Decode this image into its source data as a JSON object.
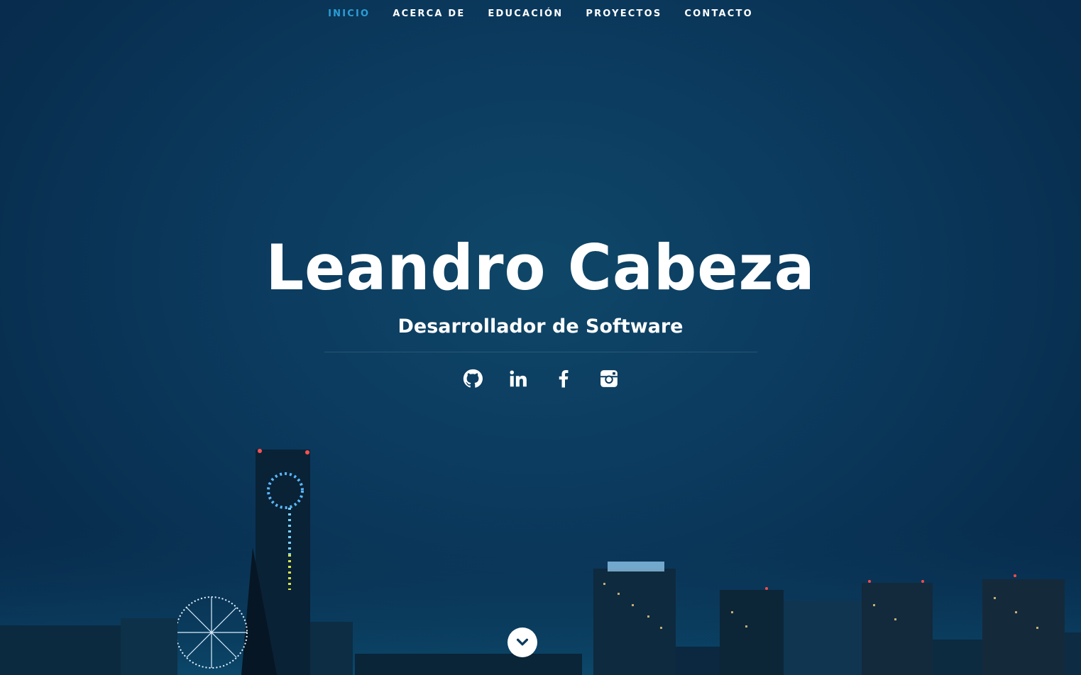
{
  "nav": {
    "items": [
      {
        "label": "INICIO",
        "active": true
      },
      {
        "label": "ACERCA DE"
      },
      {
        "label": "EDUCACIÓN"
      },
      {
        "label": "PROYECTOS"
      },
      {
        "label": "CONTACTO"
      }
    ]
  },
  "hero": {
    "name": "Leandro Cabeza",
    "subtitle": "Desarrollador de Software"
  },
  "social": {
    "icons": [
      "github-icon",
      "linkedin-icon",
      "facebook-icon",
      "instagram-icon"
    ]
  },
  "colors": {
    "accent": "#2a9fd6",
    "background": "#0b3a5e",
    "text": "#ffffff"
  }
}
